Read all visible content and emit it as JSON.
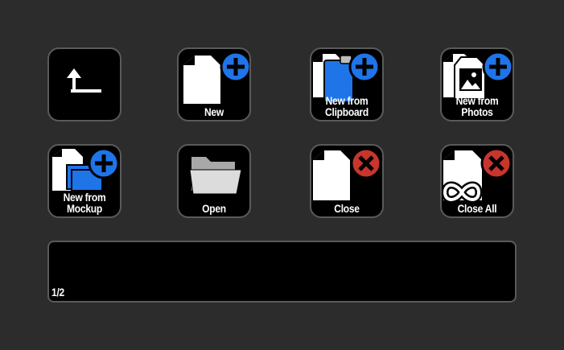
{
  "keys": [
    {
      "id": "back",
      "label": [],
      "icon": "back-arrow-icon"
    },
    {
      "id": "new",
      "label": [
        "New"
      ],
      "icon": "new-document-icon"
    },
    {
      "id": "new-from-clipboard",
      "label": [
        "New from",
        "Clipboard"
      ],
      "icon": "clipboard-document-icon"
    },
    {
      "id": "new-from-photos",
      "label": [
        "New from",
        "Photos"
      ],
      "icon": "photos-document-icon"
    },
    {
      "id": "new-from-mockup",
      "label": [
        "New from",
        "Mockup"
      ],
      "icon": "mockup-document-icon"
    },
    {
      "id": "open",
      "label": [
        "Open"
      ],
      "icon": "folder-icon"
    },
    {
      "id": "close",
      "label": [
        "Close"
      ],
      "icon": "close-document-icon"
    },
    {
      "id": "close-all",
      "label": [
        "Close All"
      ],
      "icon": "close-all-documents-icon"
    }
  ],
  "status_bar": {
    "page_indicator": "1/2"
  },
  "colors": {
    "background": "#2c2c2c",
    "key_background": "#000000",
    "key_border": "#5a5a5a",
    "add_badge": "#1f74e8",
    "close_badge": "#c8352c",
    "document": "#ffffff",
    "folder": "#d9d9d9"
  }
}
